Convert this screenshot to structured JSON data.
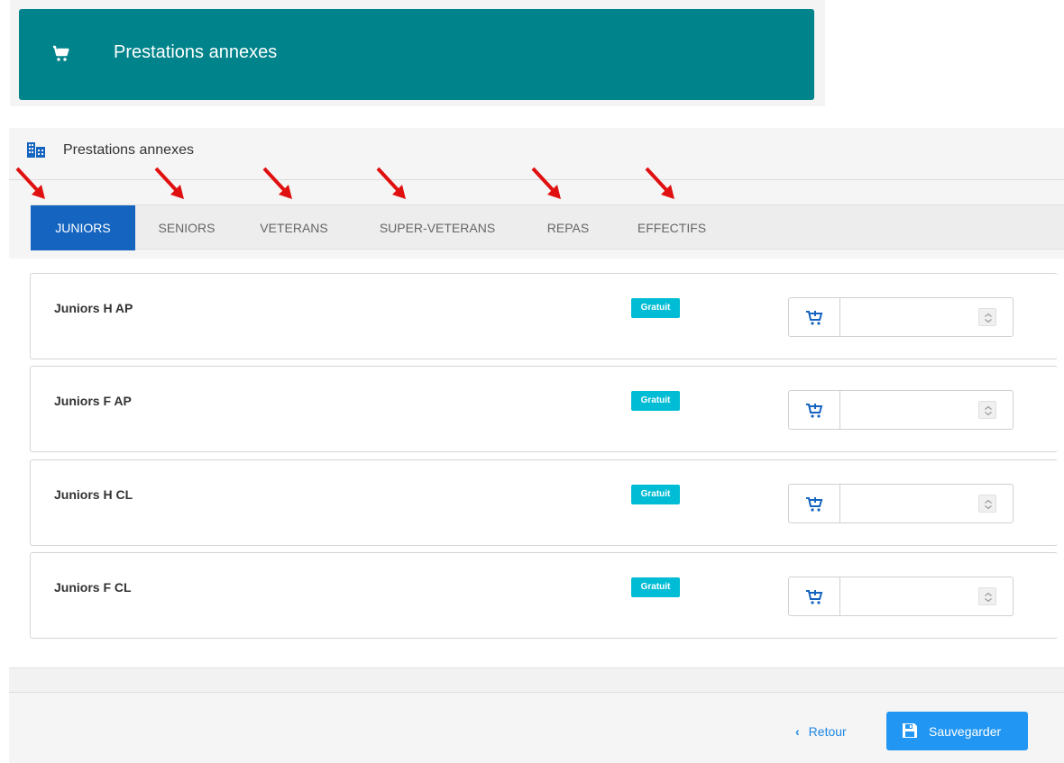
{
  "banner": {
    "title": "Prestations annexes",
    "icon": "cart-icon",
    "color": "#00838a"
  },
  "panel": {
    "title": "Prestations annexes",
    "icon": "building-icon"
  },
  "tabs": [
    {
      "label": "JUNIORS",
      "active": true
    },
    {
      "label": "SENIORS",
      "active": false
    },
    {
      "label": "VETERANS",
      "active": false
    },
    {
      "label": "SUPER-VETERANS",
      "active": false
    },
    {
      "label": "REPAS",
      "active": false
    },
    {
      "label": "EFFECTIFS",
      "active": false
    }
  ],
  "items": [
    {
      "name": "Juniors H AP",
      "badge": "Gratuit",
      "quantity": ""
    },
    {
      "name": "Juniors F AP",
      "badge": "Gratuit",
      "quantity": ""
    },
    {
      "name": "Juniors H CL",
      "badge": "Gratuit",
      "quantity": ""
    },
    {
      "name": "Juniors F CL",
      "badge": "Gratuit",
      "quantity": ""
    }
  ],
  "footer": {
    "back_label": "Retour",
    "save_label": "Sauvegarder"
  },
  "colors": {
    "accent": "#1565c0",
    "badge": "#00bcd4",
    "save": "#2196f3",
    "arrow": "#e01010"
  }
}
